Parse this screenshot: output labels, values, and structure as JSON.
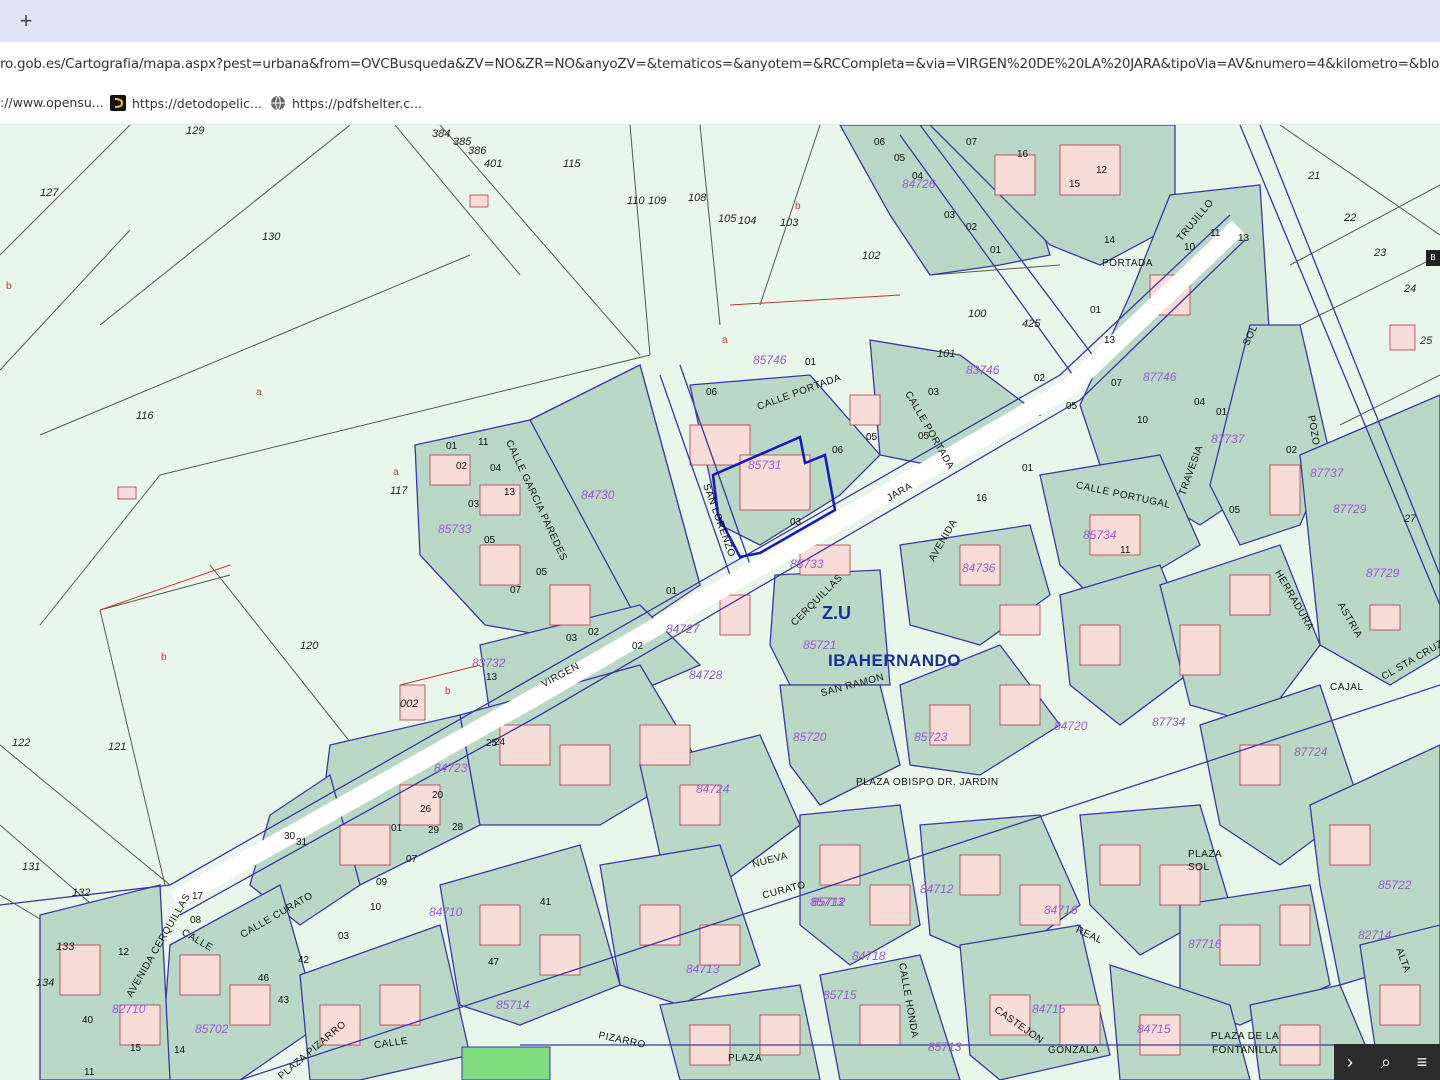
{
  "browser": {
    "new_tab": "+",
    "url": "ro.gob.es/Cartografia/mapa.aspx?pest=urbana&from=OVCBusqueda&ZV=NO&ZR=NO&anyoZV=&tematicos=&anyotem=&RCCompleta=&via=VIRGEN%20DE%20LA%20JARA&tipoVia=AV&numero=4&kilometro=&bloque=",
    "bookmarks": [
      {
        "label": "://www.opensu...",
        "icon": "page-icon"
      },
      {
        "label": "https://detodopelic...",
        "icon": "d-logo-icon"
      },
      {
        "label": "https://pdfshelter.c...",
        "icon": "globe-icon"
      }
    ]
  },
  "map": {
    "colors": {
      "rustic": "#e9f7ea",
      "urban_block": "#b9d8c6",
      "building": "#f8dcd8",
      "road": "#ffffff",
      "outline": "#3b37a6",
      "selection": "#1515c8",
      "cadastral_code": "#9b59d0"
    },
    "zu_label": "Z.U",
    "town_label": "IBAHERNANDO",
    "parcel_numbers": [
      "129",
      "127",
      "130",
      "115",
      "110",
      "109",
      "108",
      "105",
      "104",
      "103",
      "102",
      "116",
      "117",
      "100",
      "425",
      "101",
      "120",
      "121",
      "122",
      "131",
      "132",
      "133",
      "134",
      "21",
      "22",
      "23",
      "24",
      "25",
      "27",
      "002",
      "384",
      "385",
      "386",
      "401"
    ],
    "cadastral_codes": [
      "84726",
      "85746",
      "85731",
      "84730",
      "85733",
      "83746",
      "87746",
      "87737",
      "87737",
      "87729",
      "85734",
      "85733",
      "84736",
      "84727",
      "85721",
      "83732",
      "84720",
      "85720",
      "85723",
      "84723",
      "87724",
      "87729",
      "84724",
      "84710",
      "84713",
      "82710",
      "85714",
      "84715",
      "85715",
      "85713",
      "84716",
      "85713",
      "84712",
      "84718",
      "87716",
      "85712",
      "84715",
      "85702",
      "82714",
      "87734",
      "85722",
      "84728"
    ],
    "streets": [
      "CALLE",
      "PORTADA",
      "TRUJILLO",
      "CALLE PORTADA",
      "SAN LORENZO",
      "CALLE PORTADA",
      "JARA",
      "VIRGEN",
      "AVENIDA",
      "CERQUILLAS",
      "CALLE GARCIA PAREDES",
      "SAN RAMON",
      "PLAZA OBISPO DR. JARDIN",
      "CALLE PORTUGAL",
      "TRAVESIA",
      "SOL",
      "POZO",
      "CALLE",
      "HERRADURA",
      "ASTRIA",
      "CL STA CRUZ",
      "CAJAL",
      "NUEVA",
      "CURATO",
      "CALLE",
      "PIZARRO",
      "PLAZA",
      "REAL",
      "CASTEJON",
      "GONZALA",
      "PLAZA DE LA FONTANILLA",
      "PLAZA SOL",
      "AVENIDA CERQUILLAS",
      "CALLE",
      "PLAZA PIZARRO",
      "CALLE CURATO",
      "CALLE HONDA",
      "ALTA"
    ],
    "small_labels": [
      "06",
      "05",
      "04",
      "03",
      "02",
      "01",
      "07",
      "16",
      "15",
      "12",
      "14",
      "13",
      "11",
      "10",
      "09",
      "08",
      "17",
      "18",
      "19",
      "20",
      "22",
      "23",
      "24",
      "25",
      "26",
      "27",
      "28",
      "29",
      "30",
      "31",
      "33",
      "35",
      "36",
      "37",
      "38",
      "40",
      "41",
      "42",
      "43",
      "46",
      "47"
    ],
    "marker_letters": [
      "a",
      "b"
    ]
  },
  "controls": {
    "next": "›",
    "search": "⌕",
    "layers": "≡",
    "corner_badge": "B"
  }
}
